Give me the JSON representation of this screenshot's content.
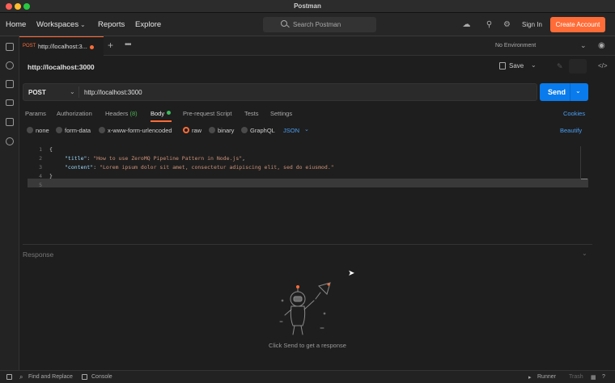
{
  "window": {
    "title": "Postman"
  },
  "nav": {
    "home": "Home",
    "workspaces": "Workspaces",
    "reports": "Reports",
    "explore": "Explore",
    "search_placeholder": "Search Postman",
    "sign_in": "Sign In",
    "create_account": "Create Account"
  },
  "tab": {
    "method": "POST",
    "url": "http://localhost:3...",
    "unsaved": true
  },
  "environment": {
    "selected": "No Environment"
  },
  "request": {
    "name": "http://localhost:3000",
    "save_label": "Save",
    "method": "POST",
    "url": "http://localhost:3000",
    "send_label": "Send"
  },
  "request_tabs": {
    "params": "Params",
    "authorization": "Authorization",
    "headers": "Headers",
    "headers_count": "(8)",
    "body": "Body",
    "pre_request": "Pre-request Script",
    "tests": "Tests",
    "settings": "Settings",
    "cookies": "Cookies"
  },
  "body_types": {
    "none": "none",
    "form_data": "form-data",
    "urlencoded": "x-www-form-urlencoded",
    "raw": "raw",
    "binary": "binary",
    "graphql": "GraphQL",
    "selected": "raw",
    "language": "JSON",
    "beautify": "Beautify"
  },
  "editor": {
    "line_numbers": [
      "1",
      "2",
      "3",
      "4",
      "5"
    ],
    "lines": [
      {
        "text": "{"
      },
      {
        "key": "\"title\"",
        "sep": ": ",
        "value": "\"How to use ZeroMQ Pipeline Pattern in Node.js\"",
        "end": ","
      },
      {
        "key": "\"content\"",
        "sep": ": ",
        "value": "\"Lorem ipsum dolor sit amet, consectetur adipiscing elit, sed do eiusmod.\"",
        "end": ""
      },
      {
        "text": "}"
      },
      {
        "text": ""
      }
    ]
  },
  "response": {
    "label": "Response",
    "empty_message": "Click Send to get a response"
  },
  "statusbar": {
    "find_replace": "Find and Replace",
    "console": "Console",
    "runner": "Runner",
    "trash": "Trash"
  },
  "colors": {
    "accent": "#ff6c37",
    "send": "#097bed",
    "link": "#4a9ff5"
  }
}
